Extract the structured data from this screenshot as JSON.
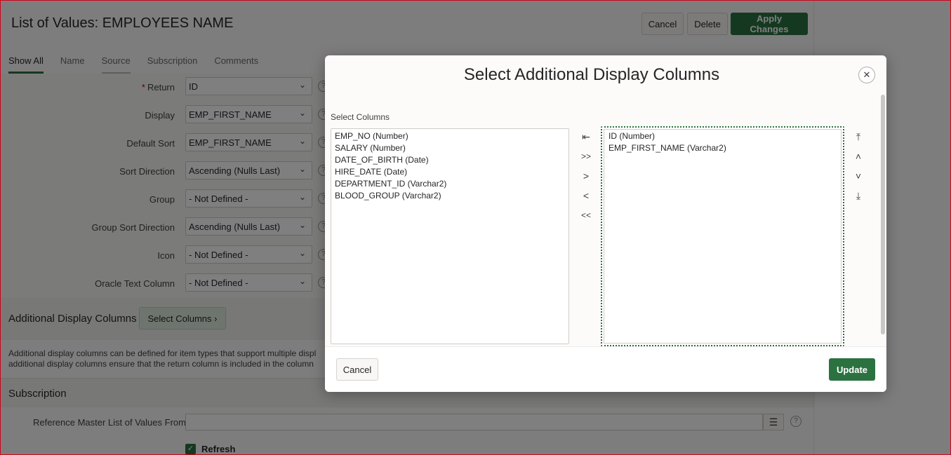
{
  "page": {
    "title": "List of Values: EMPLOYEES NAME",
    "buttons": {
      "cancel": "Cancel",
      "delete": "Delete",
      "apply": "Apply Changes"
    },
    "tabs": [
      {
        "label": "Show All"
      },
      {
        "label": "Name"
      },
      {
        "label": "Source"
      },
      {
        "label": "Subscription"
      },
      {
        "label": "Comments"
      }
    ],
    "form": {
      "required_marker": "*",
      "help_glyph": "?",
      "rows": [
        {
          "label": "Return",
          "value": "ID"
        },
        {
          "label": "Display",
          "value": "EMP_FIRST_NAME"
        },
        {
          "label": "Default Sort",
          "value": "EMP_FIRST_NAME"
        },
        {
          "label": "Sort Direction",
          "value": "Ascending (Nulls Last)"
        },
        {
          "label": "Group",
          "value": "- Not Defined -"
        },
        {
          "label": "Group Sort Direction",
          "value": "Ascending (Nulls Last)"
        },
        {
          "label": "Icon",
          "value": "- Not Defined -"
        },
        {
          "label": "Oracle Text Column",
          "value": "- Not Defined -"
        }
      ]
    },
    "additional_display": {
      "title": "Additional Display Columns",
      "button": "Select Columns",
      "button_chevron": "›",
      "description_line1": "Additional display columns can be defined for item types that support multiple displ",
      "description_line2": "additional display columns ensure that the return column is included in the column"
    },
    "subscription": {
      "title": "Subscription",
      "ref_label": "Reference Master List of Values From",
      "ref_list_glyph": "☰",
      "refresh_label": "Refresh",
      "checkbox_glyph": "✓"
    }
  },
  "dialog": {
    "title": "Select Additional Display Columns",
    "close_glyph": "✕",
    "select_label": "Select Columns",
    "available": [
      "EMP_NO (Number)",
      "SALARY (Number)",
      "DATE_OF_BIRTH (Date)",
      "HIRE_DATE (Date)",
      "DEPARTMENT_ID (Varchar2)",
      "BLOOD_GROUP (Varchar2)"
    ],
    "selected": [
      "ID (Number)",
      "EMP_FIRST_NAME (Varchar2)"
    ],
    "move_glyphs": {
      "reset": "⇤",
      "move_all": ">>",
      "move": ">",
      "remove": "<",
      "remove_all": "<<",
      "top": "⤒",
      "up": "˄",
      "down": "˅",
      "bottom": "⤓"
    },
    "cancel": "Cancel",
    "update": "Update"
  },
  "colors": {
    "primary": "#2b7240",
    "overlay": "rgba(0,0,0,0.5)"
  }
}
